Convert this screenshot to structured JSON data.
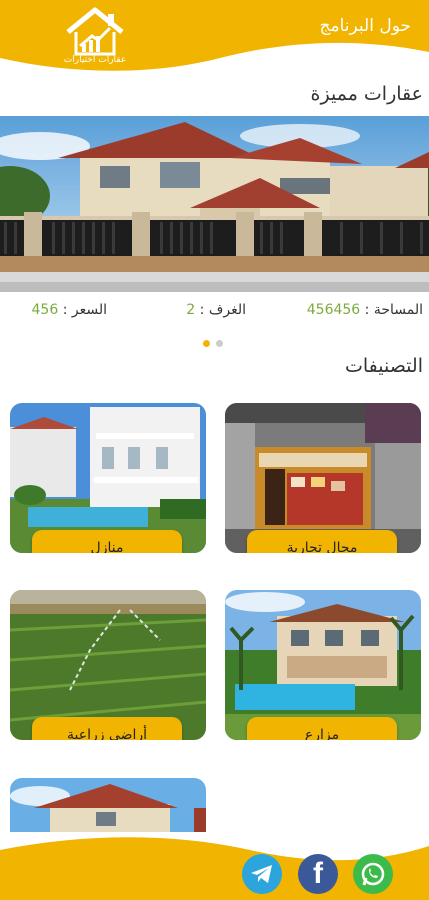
{
  "header": {
    "about_label": "حول البرنامج",
    "logo_text": "عقارات اختيارات"
  },
  "featured": {
    "title": "عقارات مميزة",
    "area_label": "المساحة :",
    "area_value": "456456",
    "rooms_label": "الغرف :",
    "rooms_value": "2",
    "price_label": "السعر :",
    "price_value": "456",
    "slides_count": 2,
    "active_slide": 1
  },
  "categories": {
    "title": "التصنيفات",
    "items": [
      {
        "label": "محال تجارية",
        "image": "shop-storefront"
      },
      {
        "label": "منازل",
        "image": "white-villa-pool"
      },
      {
        "label": "مزارع",
        "image": "villa-pool-palms"
      },
      {
        "label": "أراضي زراعية",
        "image": "green-field-irrigation"
      },
      {
        "label": "",
        "image": "villa-red-roof"
      }
    ]
  },
  "footer": {
    "icons": [
      "telegram-icon",
      "facebook-icon",
      "whatsapp-icon"
    ]
  },
  "colors": {
    "brand": "#f1b400",
    "value_green": "#7cab3c",
    "dot_active": "#f1b400",
    "dot_inactive": "#cccccc"
  }
}
